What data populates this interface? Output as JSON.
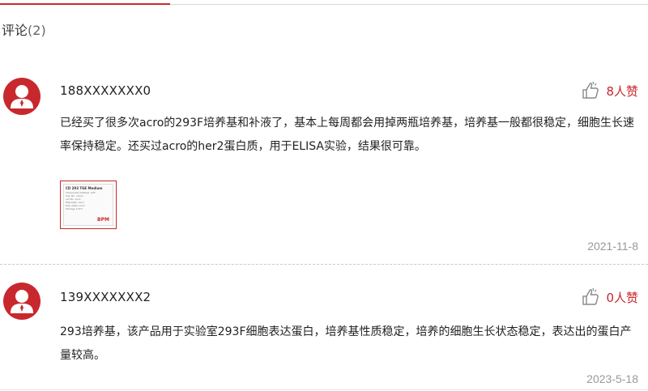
{
  "section": {
    "title": "评论",
    "count": "(2)"
  },
  "comments": [
    {
      "username": "188XXXXXXX0",
      "likes": "8人赞",
      "content_line1": "已经买了很多次acro的293F培养基和补液了，基本上每周都会用掉两瓶培养基，培养基一般都很稳定，细胞生长速",
      "content_line2": "率保持稳定。还买过acro的her2蛋白质，用于ELISA实验，结果很可靠。",
      "image": {
        "title": "CD 293 TGE Medium",
        "lines": [
          "Chemically Defined, ACF",
          "Cat. No. xxxxx",
          "Lot No. xxxx",
          "Mfg Date: xxxx",
          "Exp. Date: xxxx",
          "Storage 2-8°C"
        ],
        "brand": "BPM"
      },
      "date": "2021-11-8"
    },
    {
      "username": "139XXXXXXX2",
      "likes": "0人赞",
      "content_line1": "293培养基，该产品用于实验室293F细胞表达蛋白，培养基性质稳定，培养的细胞生长状态稳定，表达出的蛋白产",
      "content_line2": "量较高。",
      "date": "2023-5-18"
    }
  ],
  "colors": {
    "accent": "#c8282d",
    "muted": "#999999"
  },
  "icons": {
    "avatar": "user-avatar-icon",
    "like": "thumbs-up-icon"
  }
}
